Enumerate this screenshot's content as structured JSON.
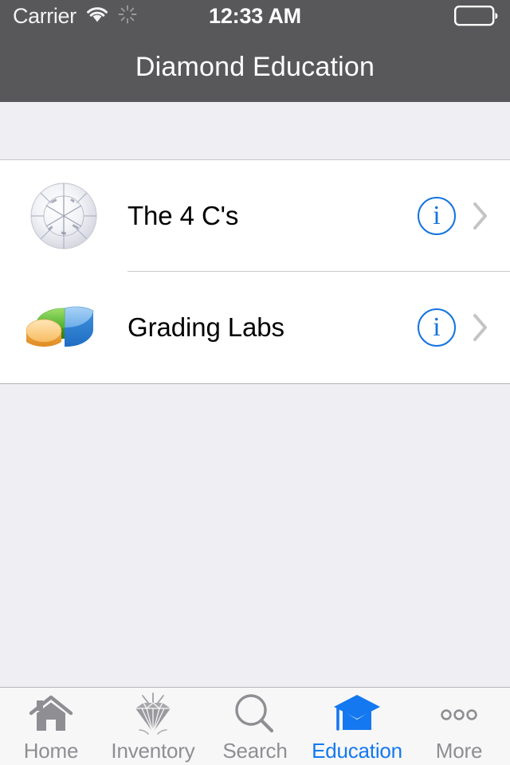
{
  "status_bar": {
    "carrier": "Carrier",
    "wifi_icon": "wifi-icon",
    "activity_icon": "network-activity-spinner-icon",
    "time": "12:33 AM",
    "battery_icon": "battery-icon"
  },
  "nav": {
    "title": "Diamond Education"
  },
  "list": {
    "rows": [
      {
        "label": "The 4 C's",
        "icon": "round-brilliant-diamond-icon",
        "info_label": "i",
        "disclosure": "chevron-right-icon"
      },
      {
        "label": "Grading Labs",
        "icon": "pie-chart-3d-icon",
        "info_label": "i",
        "disclosure": "chevron-right-icon"
      }
    ]
  },
  "tabbar": {
    "active_color": "#1478f0",
    "inactive_color": "#8e8e93",
    "tabs": [
      {
        "label": "Home",
        "icon": "house-icon",
        "active": false
      },
      {
        "label": "Inventory",
        "icon": "diamond-icon",
        "active": false
      },
      {
        "label": "Search",
        "icon": "magnifier-icon",
        "active": false
      },
      {
        "label": "Education",
        "icon": "graduation-cap-icon",
        "active": true
      },
      {
        "label": "More",
        "icon": "ellipsis-icon",
        "active": false
      }
    ]
  },
  "colors": {
    "navbar_bg": "#58585a",
    "page_bg": "#eeeef3",
    "list_bg": "#ffffff",
    "accent": "#1474e0"
  }
}
